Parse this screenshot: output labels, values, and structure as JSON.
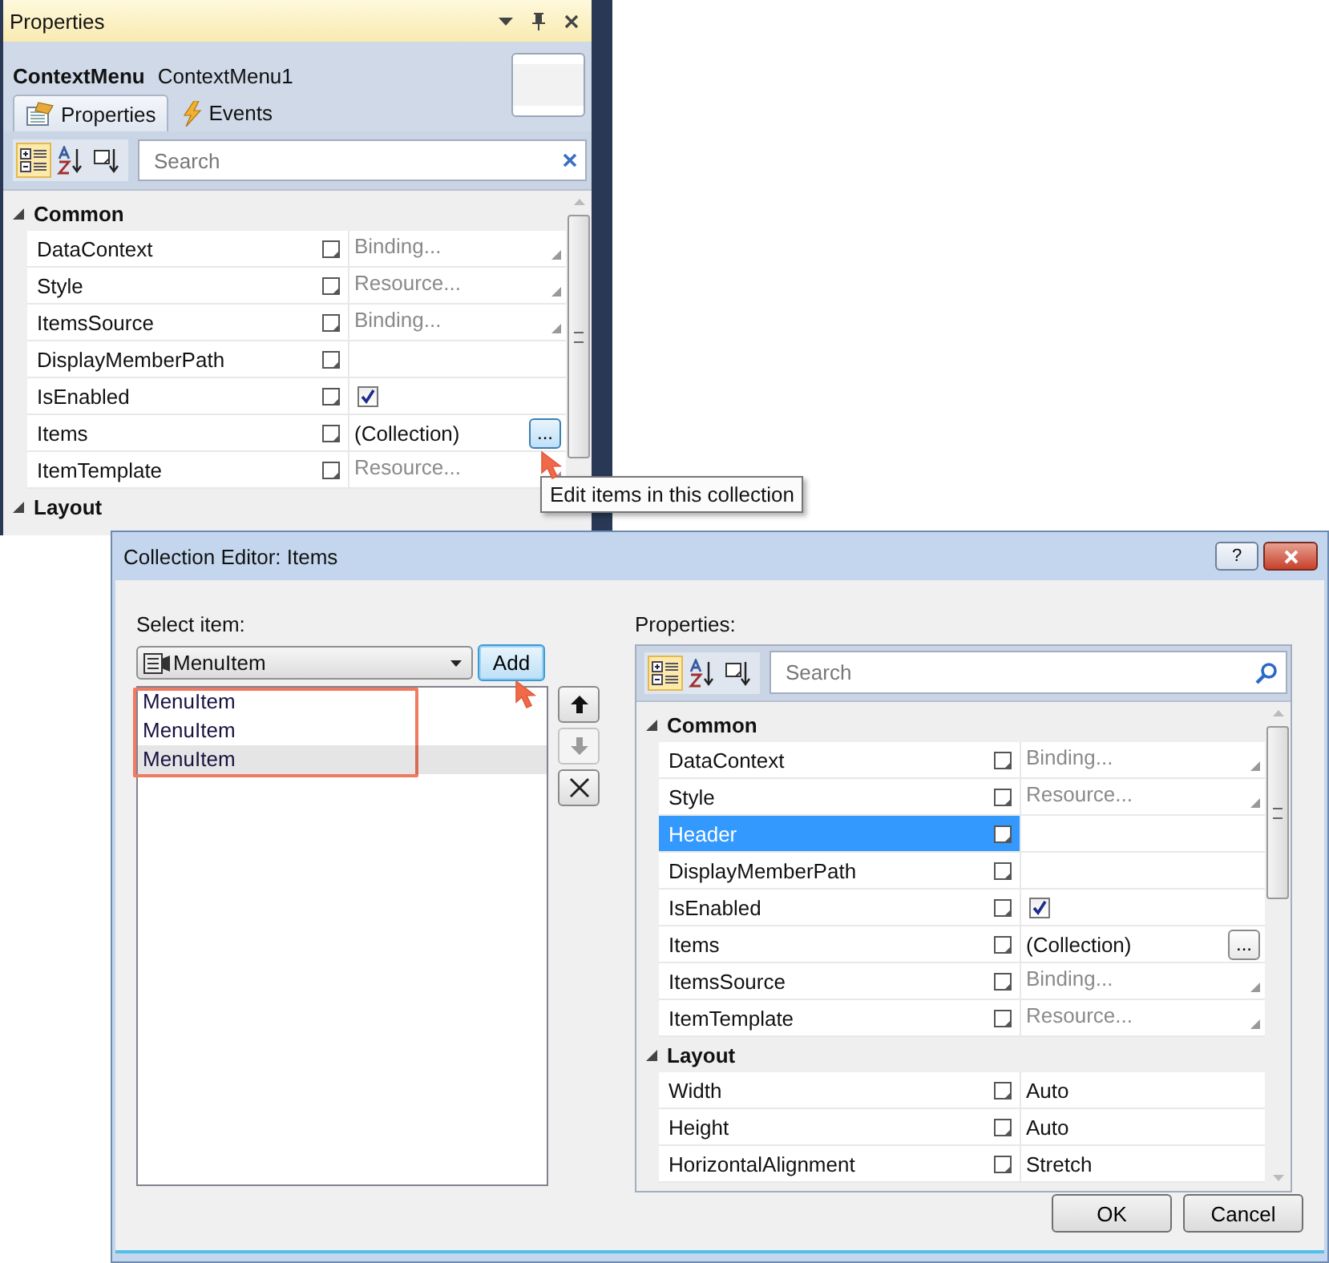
{
  "properties_panel": {
    "title": "Properties",
    "element_type": "ContextMenu",
    "element_name": "ContextMenu1",
    "tabs": [
      {
        "label": "Properties",
        "kind": "properties",
        "selected": true
      },
      {
        "label": "Events",
        "kind": "events",
        "selected": false
      }
    ],
    "view_modes": [
      {
        "kind": "category",
        "selected": true
      },
      {
        "kind": "alpha",
        "selected": false
      },
      {
        "kind": "source",
        "selected": false
      }
    ],
    "search": {
      "placeholder": "Search"
    },
    "groups": [
      {
        "name": "Common",
        "expanded": true,
        "rows": [
          {
            "name": "DataContext",
            "kind": "resource",
            "value": "Binding...",
            "selected": false
          },
          {
            "name": "Style",
            "kind": "resource",
            "value": "Resource...",
            "selected": false
          },
          {
            "name": "ItemsSource",
            "kind": "resource",
            "value": "Binding...",
            "selected": false
          },
          {
            "name": "DisplayMemberPath",
            "kind": "empty",
            "selected": false
          },
          {
            "name": "IsEnabled",
            "kind": "checkbox",
            "checked": true,
            "selected": false
          },
          {
            "name": "Items",
            "kind": "collection",
            "value": "(Collection)",
            "button": "...",
            "selected": false
          },
          {
            "name": "ItemTemplate",
            "kind": "resource",
            "value": "Resource...",
            "selected": false
          }
        ]
      },
      {
        "name": "Layout",
        "expanded": true
      }
    ],
    "tooltip": "Edit items in this collection"
  },
  "collection_editor": {
    "title": "Collection Editor: Items",
    "help_button": "?",
    "select_label": "Select item:",
    "item_type": "MenuItem",
    "add_button": "Add",
    "items": [
      {
        "label": "MenuItem",
        "selected": false
      },
      {
        "label": "MenuItem",
        "selected": false
      },
      {
        "label": "MenuItem",
        "selected": true
      }
    ],
    "move_buttons": [
      {
        "kind": "up",
        "disabled": false
      },
      {
        "kind": "down",
        "disabled": true
      },
      {
        "kind": "remove",
        "disabled": false
      }
    ],
    "properties_label": "Properties:",
    "view_modes": [
      {
        "kind": "category",
        "selected": true
      },
      {
        "kind": "alpha",
        "selected": false
      },
      {
        "kind": "source",
        "selected": false
      }
    ],
    "search": {
      "placeholder": "Search"
    },
    "groups": [
      {
        "name": "Common",
        "expanded": true,
        "rows": [
          {
            "name": "DataContext",
            "kind": "resource",
            "value": "Binding...",
            "selected": false
          },
          {
            "name": "Style",
            "kind": "resource",
            "value": "Resource...",
            "selected": false
          },
          {
            "name": "Header",
            "kind": "empty",
            "selected": true
          },
          {
            "name": "DisplayMemberPath",
            "kind": "empty",
            "selected": false
          },
          {
            "name": "IsEnabled",
            "kind": "checkbox",
            "checked": true,
            "selected": false
          },
          {
            "name": "Items",
            "kind": "collection",
            "value": "(Collection)",
            "button": "...",
            "selected": false
          },
          {
            "name": "ItemsSource",
            "kind": "resource",
            "value": "Binding...",
            "selected": false
          },
          {
            "name": "ItemTemplate",
            "kind": "resource",
            "value": "Resource...",
            "selected": false
          }
        ]
      },
      {
        "name": "Layout",
        "expanded": true,
        "rows": [
          {
            "name": "Width",
            "kind": "text",
            "value": "Auto",
            "selected": false
          },
          {
            "name": "Height",
            "kind": "text",
            "value": "Auto",
            "selected": false
          },
          {
            "name": "HorizontalAlignment",
            "kind": "text",
            "value": "Stretch",
            "selected": false
          }
        ]
      }
    ],
    "buttons": [
      "OK",
      "Cancel"
    ]
  }
}
